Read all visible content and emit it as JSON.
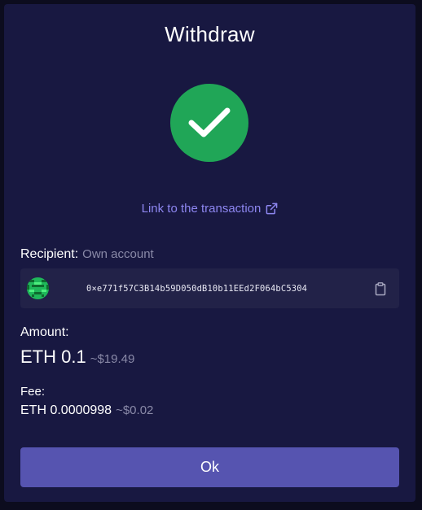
{
  "dialog": {
    "title": "Withdraw",
    "status_icon": "checkmark-icon",
    "colors": {
      "background": "#181841",
      "success": "#20a657",
      "link": "#8d86f0",
      "primary_button": "#5654b0",
      "muted_text": "#8a8aa8"
    }
  },
  "transaction": {
    "link_label": "Link to the transaction",
    "link_icon": "external-link-icon"
  },
  "recipient": {
    "label": "Recipient:",
    "type": "Own account",
    "address": "0×e771f57C3B14b59D050dB10b11EEd2F064bC5304",
    "avatar_icon": "identicon-avatar",
    "copy_icon": "clipboard-icon"
  },
  "amount": {
    "label": "Amount:",
    "value": "ETH 0.1",
    "usd": "~$19.49"
  },
  "fee": {
    "label": "Fee:",
    "value": "ETH 0.0000998",
    "usd": "~$0.02"
  },
  "actions": {
    "ok_label": "Ok"
  }
}
